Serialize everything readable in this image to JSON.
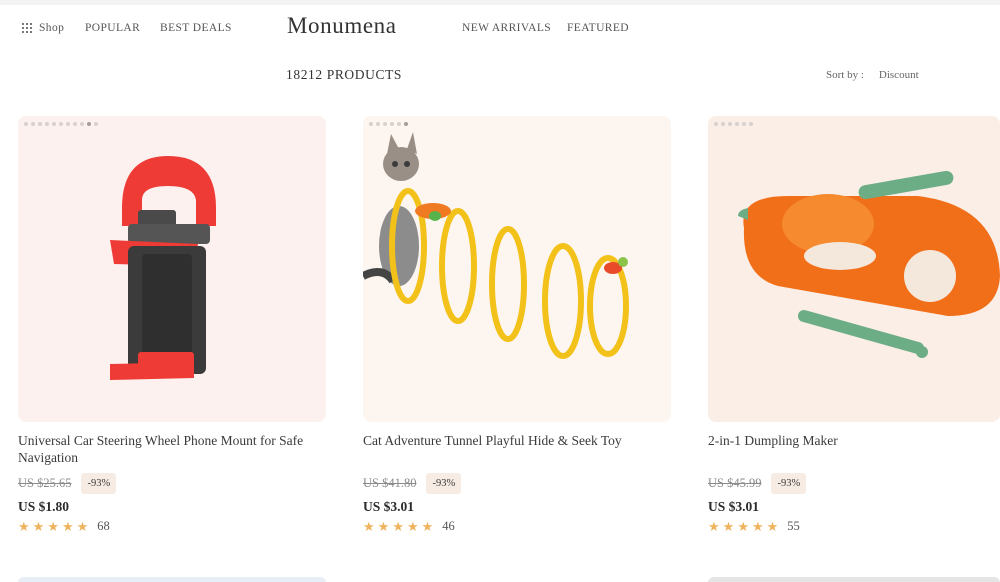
{
  "nav": {
    "shop": "Shop",
    "popular": "POPULAR",
    "best_deals": "BEST DEALS",
    "logo": "Monumena",
    "new_arrivals": "NEW ARRIVALS",
    "featured": "FEATURED"
  },
  "listing": {
    "count": "18212 PRODUCTS",
    "sort_label": "Sort by :",
    "sort_value": "Discount"
  },
  "products": [
    {
      "title": "Universal Car Steering Wheel Phone Mount for Safe Navigation",
      "old_price": "US $25.65",
      "discount": "-93%",
      "price": "US $1.80",
      "rating": 4.5,
      "reviews": "68",
      "image_icon": "phone-mount"
    },
    {
      "title": "Cat Adventure Tunnel Playful Hide & Seek Toy",
      "old_price": "US $41.80",
      "discount": "-93%",
      "price": "US $3.01",
      "rating": 4.5,
      "reviews": "46",
      "image_icon": "cat-tunnel"
    },
    {
      "title": "2-in-1 Dumpling Maker",
      "old_price": "US $45.99",
      "discount": "-93%",
      "price": "US $3.01",
      "rating": 4.5,
      "reviews": "55",
      "image_icon": "dumpling-maker"
    }
  ],
  "colors": {
    "star": "#f0b35d",
    "discount_bg": "#f7ece3",
    "card_bg": "#fdf2ee"
  }
}
